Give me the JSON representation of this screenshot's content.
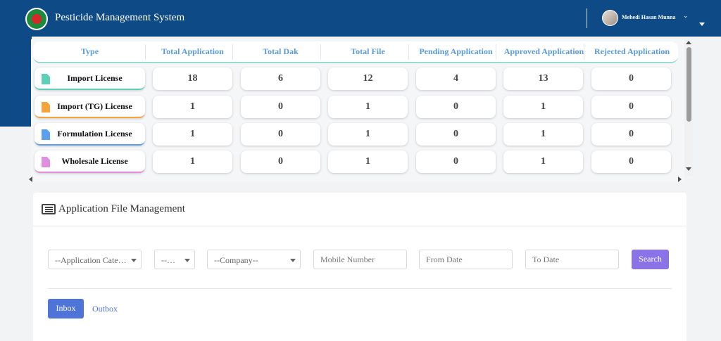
{
  "header": {
    "app_title": "Pesticide Management System",
    "user_name": "Mehedi Hasan Munna",
    "user_chevron": "⌄"
  },
  "stats": {
    "columns": [
      "Type",
      "Total Application",
      "Total Dak",
      "Total File",
      "Pending Application",
      "Approved Application",
      "Rejected Application"
    ],
    "rows": [
      {
        "type": "Import License",
        "doc_color": "#5fd0b8",
        "underline": "#5fd0b8",
        "values": [
          "18",
          "6",
          "12",
          "4",
          "13",
          "0"
        ]
      },
      {
        "type": "Import (TG) License",
        "doc_color": "#f5a33c",
        "underline": "#f5a33c",
        "values": [
          "1",
          "0",
          "1",
          "0",
          "1",
          "0"
        ]
      },
      {
        "type": "Formulation License",
        "doc_color": "#5aa0ee",
        "underline": "#5aa0ee",
        "values": [
          "1",
          "0",
          "1",
          "0",
          "1",
          "0"
        ]
      },
      {
        "type": "Wholesale License",
        "doc_color": "#e08ee0",
        "underline": "#e08ee0",
        "values": [
          "1",
          "0",
          "1",
          "0",
          "1",
          "0"
        ]
      }
    ]
  },
  "file_management": {
    "title": "Application File Management",
    "filters": {
      "category": "--Application Cate…",
      "status": "--…",
      "company": "--Company--",
      "mobile_placeholder": "Mobile Number",
      "from_date_placeholder": "From Date",
      "to_date_placeholder": "To Date"
    },
    "search_label": "Search",
    "inbox_label": "Inbox",
    "outbox_label": "Outbox"
  }
}
